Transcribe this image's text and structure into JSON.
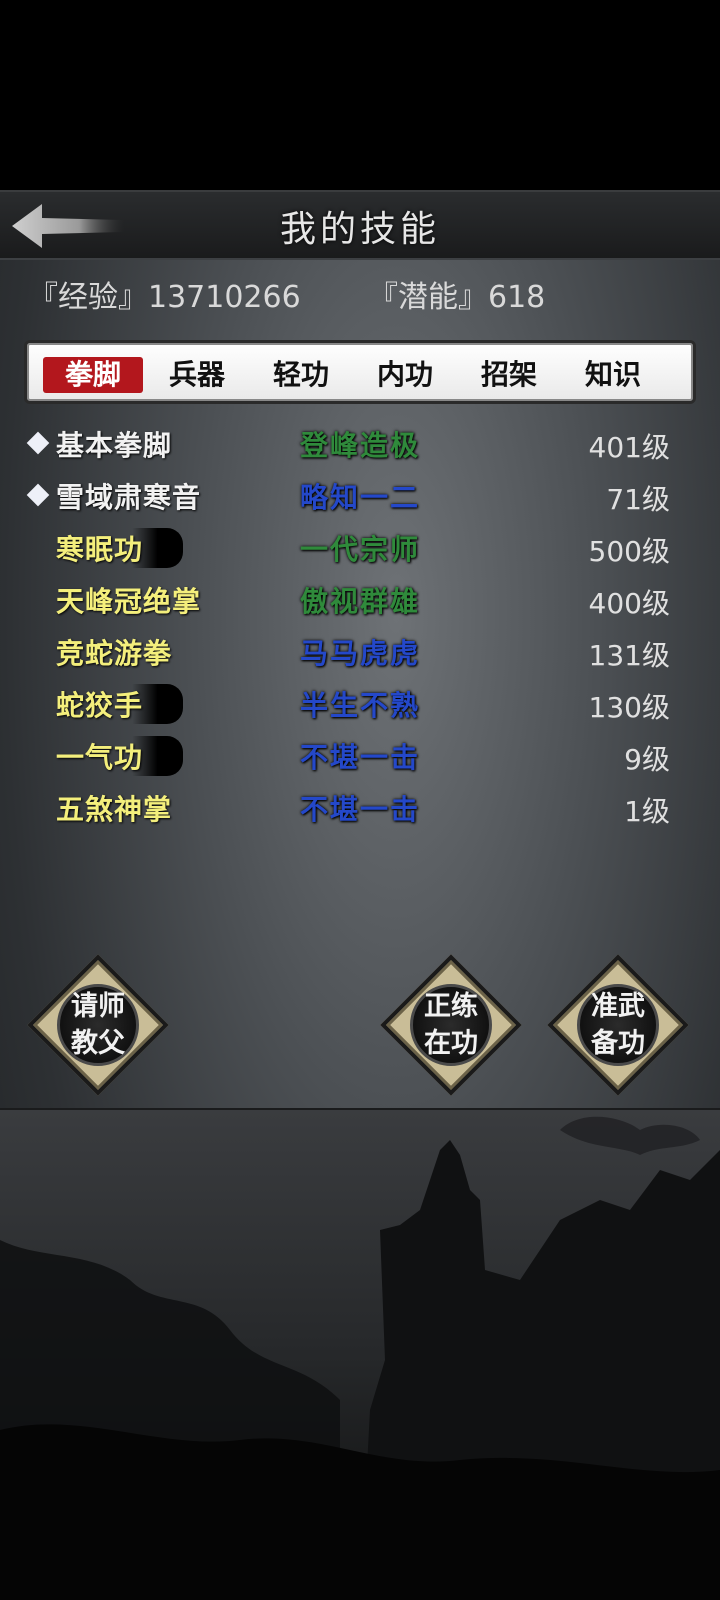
{
  "header": {
    "title": "我的技能",
    "back_icon": "back-arrow-icon"
  },
  "stats": {
    "experience": "『经验』13710266",
    "potential": "『潜能』618"
  },
  "tabs": [
    {
      "label": "拳脚",
      "active": true
    },
    {
      "label": "兵器",
      "active": false
    },
    {
      "label": "轻功",
      "active": false
    },
    {
      "label": "内功",
      "active": false
    },
    {
      "label": "招架",
      "active": false
    },
    {
      "label": "知识",
      "active": false
    }
  ],
  "skills": [
    {
      "name": "基本拳脚",
      "level_text": "登峰造极",
      "grade": "401级"
    },
    {
      "name": "雪域肃寒音",
      "level_text": "略知一二",
      "grade": "71级"
    },
    {
      "name": "寒眠功",
      "level_text": "一代宗师",
      "grade": "500级"
    },
    {
      "name": "天峰冠绝掌",
      "level_text": "傲视群雄",
      "grade": "400级"
    },
    {
      "name": "竞蛇游拳",
      "level_text": "马马虎虎",
      "grade": "131级"
    },
    {
      "name": "蛇狡手",
      "level_text": "半生不熟",
      "grade": "130级"
    },
    {
      "name": "一气功",
      "level_text": "不堪一击",
      "grade": "9级"
    },
    {
      "name": "五煞神掌",
      "level_text": "不堪一击",
      "grade": "1级"
    }
  ],
  "actions": [
    {
      "line1": "请师",
      "line2": "教父"
    },
    {
      "line1": "正练",
      "line2": "在功"
    },
    {
      "line1": "准武",
      "line2": "备功"
    }
  ],
  "colors": {
    "active_tab": "#b3171d",
    "level_green": "#2f8a3b",
    "level_blue": "#2448c9",
    "name_yellow": "#f4ef7c"
  }
}
